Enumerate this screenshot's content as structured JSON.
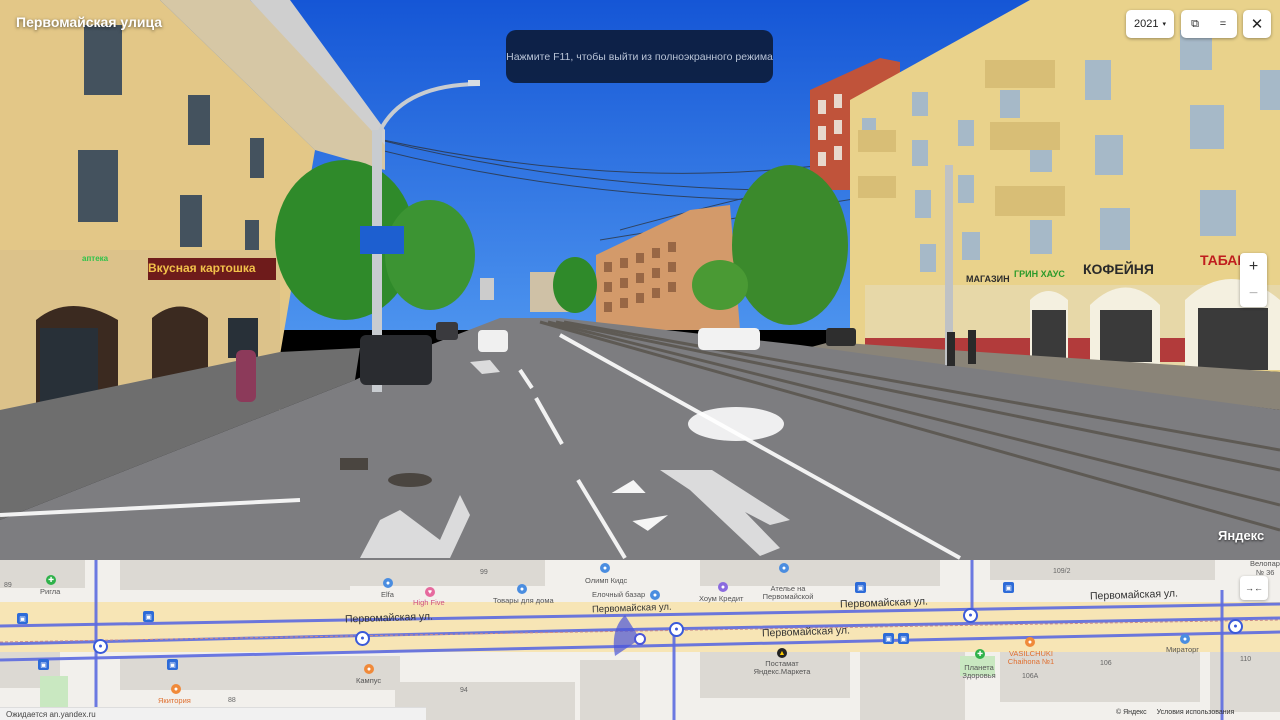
{
  "panorama": {
    "street_title": "Первомайская улица",
    "fullscreen_toast": "Нажмите F11, чтобы выйти из полноэкранного режима",
    "year": "2021",
    "year_caret": "▾",
    "share_icon": "⧉",
    "menu_icon": "=",
    "close_icon": "✕",
    "zoom_in": "+",
    "zoom_out": "−",
    "brand": "Яндекс",
    "signs": {
      "left_pharmacy": "аптека",
      "left_shop": "Вкусная картошка",
      "right_magazin": "МАГАЗИН",
      "right_green": "ГРИН ХАУС",
      "right_coffee": "КОФЕЙНЯ",
      "right_tabak": "ТАБАК"
    },
    "colors": {
      "sky": "#1f6de0",
      "road": "#7a7a7e",
      "building_yellow": "#e8d28c"
    }
  },
  "minimap": {
    "streets": [
      "Первомайская ул.",
      "Первомайская ул.",
      "Первомайская ул.",
      "Первомайская ул.",
      "Первомайская ул."
    ],
    "pois": {
      "rigla": "Ригла",
      "elfa": "Elfa",
      "high_five": "High Five",
      "tovary": "Товары для дома",
      "olimp": "Олимп Кидс",
      "elochny": "Елочный базар",
      "houm": "Хоум Кредит",
      "atelie": "Ателье на Первомайской",
      "postamat": "Постамат Яндекс.Маркета",
      "kampus": "Кампус",
      "yakitoriya": "Якитория",
      "planeta": "Планета Здоровья",
      "vasilchuki": "VASILCHUKI Chaihona №1",
      "miratorg": "Мираторг",
      "velopar": "Велопар",
      "velopar_num": "№ 36"
    },
    "house_numbers": [
      "89",
      "99",
      "109/2",
      "94",
      "88",
      "106",
      "106А",
      "110"
    ],
    "collapse_icon": "→←",
    "status": "Ожидается an.yandex.ru",
    "footer_brand": "© Яндекс",
    "footer_terms": "Условия использования"
  }
}
